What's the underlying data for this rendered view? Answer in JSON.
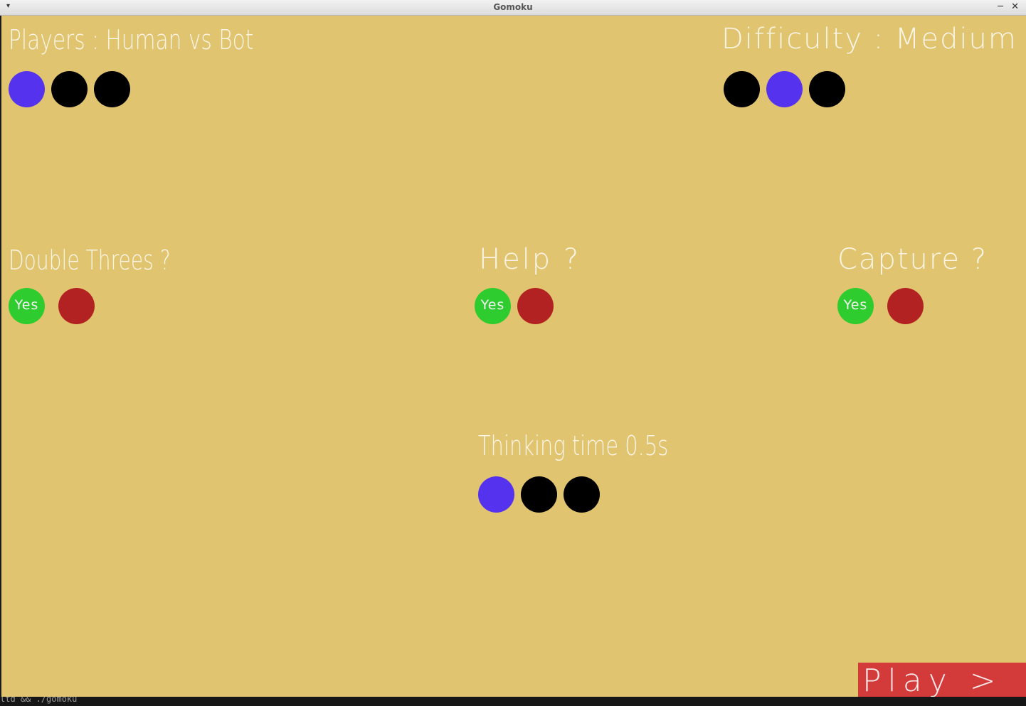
{
  "window": {
    "title": "Gomoku"
  },
  "players": {
    "label": "Players : Human vs Bot",
    "options": [
      {
        "color": "#5533ee"
      },
      {
        "color": "#000000"
      },
      {
        "color": "#000000"
      }
    ]
  },
  "difficulty": {
    "label": "Difficulty : Medium",
    "options": [
      {
        "color": "#000000"
      },
      {
        "color": "#5533ee"
      },
      {
        "color": "#000000"
      }
    ]
  },
  "double_threes": {
    "label": "Double Threes ?",
    "yes_label": "Yes"
  },
  "help": {
    "label": "Help ?",
    "yes_label": "Yes"
  },
  "capture": {
    "label": "Capture ?",
    "yes_label": "Yes"
  },
  "thinking_time": {
    "label": "Thinking time 0.5s",
    "options": [
      {
        "color": "#5533ee"
      },
      {
        "color": "#000000"
      },
      {
        "color": "#000000"
      }
    ]
  },
  "play_button": {
    "label": "Play >"
  },
  "terminal_fragment": "ltd && ./gomoku",
  "colors": {
    "background": "#e1c46f",
    "selected": "#5533ee",
    "unselected": "#000000",
    "yes": "#2ecc2e",
    "no": "#b22222",
    "play": "#d33b3b"
  }
}
